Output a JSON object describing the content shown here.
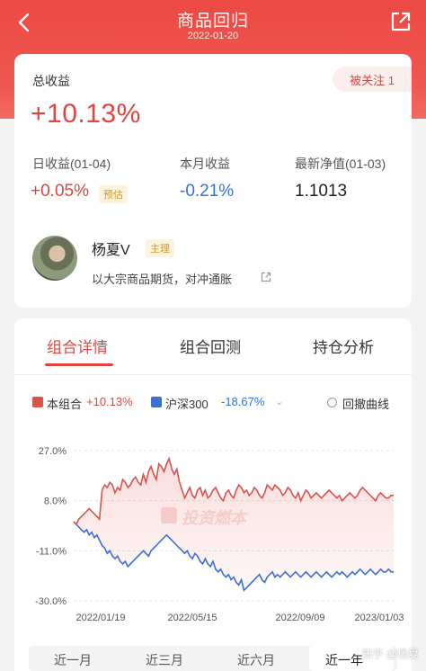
{
  "nav": {
    "title": "商品回归",
    "date": "2022-01-20",
    "back_icon": "chevron-left-icon",
    "share_icon": "share-icon"
  },
  "summary": {
    "total_label": "总收益",
    "total_value": "+10.13%",
    "follow_badge": "被关注 1",
    "daily_label": "日收益(01-04)",
    "daily_value": "+0.05%",
    "daily_tag": "预估",
    "monthly_label": "本月收益",
    "monthly_value": "-0.21%",
    "nav_label": "最新净值(01-03)",
    "nav_value": "1.1013"
  },
  "author": {
    "name": "杨夏V",
    "role": "主理",
    "description": "以大宗商品期货，对冲通胀"
  },
  "tabs": [
    "组合详情",
    "组合回测",
    "持仓分析"
  ],
  "legend": {
    "portfolio_label": "本组合",
    "portfolio_pct": "+10.13%",
    "benchmark_label": "沪深300",
    "benchmark_pct": "-18.67%",
    "drawdown_label": "回撤曲线"
  },
  "watermark": "投资燃本",
  "periods": [
    "近一月",
    "近三月",
    "近六月",
    "近一年"
  ],
  "active_period": "近一年",
  "credit": "知乎 @杨夏",
  "colors": {
    "accent": "#e0463f",
    "portfolio": "#d9534f",
    "benchmark": "#3f6fd1",
    "up": "#e0463f",
    "down": "#3a6fd6"
  },
  "chart_data": {
    "type": "line",
    "y_ticks": [
      "27.0%",
      "8.0%",
      "-11.0%",
      "-30.0%"
    ],
    "x_ticks": [
      "2022/01/19",
      "2022/05/15",
      "2022/09/09",
      "2023/01/03"
    ],
    "ylim": [
      -30,
      27
    ],
    "series": [
      {
        "name": "本组合",
        "values": [
          0,
          -1,
          1,
          2,
          3,
          4,
          5,
          4,
          3,
          2,
          1,
          12,
          14,
          13,
          15,
          14,
          11,
          13,
          12,
          16,
          15,
          13,
          14,
          16,
          17,
          15,
          14,
          18,
          15,
          19,
          21,
          18,
          16,
          22,
          21,
          19,
          22,
          24,
          20,
          18,
          20,
          15,
          12,
          9,
          11,
          13,
          10,
          9,
          12,
          13,
          10,
          12,
          9,
          10,
          12,
          13,
          11,
          9,
          8,
          11,
          12,
          10,
          9,
          12,
          14,
          13,
          11,
          12,
          10,
          11,
          13,
          12,
          10,
          9,
          11,
          14,
          13,
          12,
          14,
          13,
          12,
          10,
          11,
          13,
          12,
          10,
          9,
          11,
          8,
          10,
          12,
          11,
          9,
          10,
          11,
          10,
          9,
          10,
          11,
          12,
          11,
          10,
          9,
          10,
          8,
          9,
          10,
          11,
          10,
          9,
          10,
          12,
          13,
          12,
          11,
          10,
          9,
          8,
          10,
          11,
          10,
          9,
          9,
          10,
          10
        ]
      },
      {
        "name": "沪深300",
        "values": [
          0,
          -1,
          -2,
          -3,
          -4,
          -3,
          -5,
          -4,
          -6,
          -5,
          -7,
          -9,
          -10,
          -12,
          -11,
          -13,
          -14,
          -13,
          -15,
          -16,
          -15,
          -17,
          -16,
          -15,
          -14,
          -13,
          -12,
          -11,
          -12,
          -13,
          -11,
          -10,
          -9,
          -8,
          -7,
          -6,
          -5,
          -6,
          -7,
          -8,
          -9,
          -10,
          -11,
          -12,
          -11,
          -13,
          -14,
          -12,
          -13,
          -15,
          -16,
          -14,
          -16,
          -17,
          -15,
          -18,
          -19,
          -18,
          -20,
          -21,
          -20,
          -22,
          -21,
          -23,
          -24,
          -22,
          -26,
          -25,
          -24,
          -23,
          -22,
          -21,
          -20,
          -22,
          -23,
          -21,
          -20,
          -19,
          -21,
          -20,
          -21,
          -20,
          -19,
          -20,
          -21,
          -20,
          -19,
          -20,
          -21,
          -20,
          -19,
          -20,
          -21,
          -20,
          -19,
          -20,
          -21,
          -20,
          -19,
          -20,
          -21,
          -20,
          -19,
          -20,
          -19,
          -20,
          -21,
          -20,
          -19,
          -20,
          -19,
          -18,
          -19,
          -20,
          -19,
          -18,
          -19,
          -20,
          -19,
          -18,
          -19,
          -19,
          -18,
          -19,
          -19
        ]
      }
    ]
  }
}
